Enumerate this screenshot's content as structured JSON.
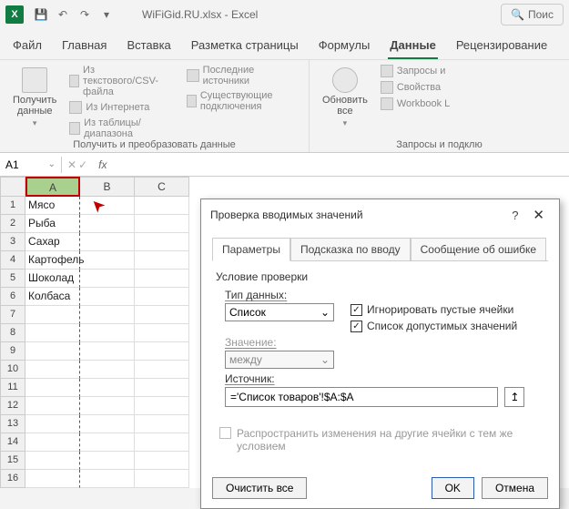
{
  "title": {
    "filename": "WiFiGid.RU.xlsx",
    "app": "Excel"
  },
  "search_label": "Поис",
  "tabs": [
    "Файл",
    "Главная",
    "Вставка",
    "Разметка страницы",
    "Формулы",
    "Данные",
    "Рецензирование"
  ],
  "active_tab": "Данные",
  "ribbon": {
    "get_data": "Получить данные",
    "from_csv": "Из текстового/CSV-файла",
    "from_web": "Из Интернета",
    "from_table": "Из таблицы/диапазона",
    "recent": "Последние источники",
    "existing": "Существующие подключения",
    "group1_label": "Получить и преобразовать данные",
    "refresh": "Обновить все",
    "queries": "Запросы и",
    "properties": "Свойства",
    "workbook": "Workbook L",
    "group2_label": "Запросы и подклю"
  },
  "namebox": "A1",
  "columns": [
    "A",
    "B",
    "C"
  ],
  "cells": {
    "a": [
      "Мясо",
      "Рыба",
      "Сахар",
      "Картофель",
      "Шоколад",
      "Колбаса",
      "",
      "",
      "",
      "",
      "",
      "",
      "",
      "",
      "",
      ""
    ]
  },
  "dialog": {
    "title": "Проверка вводимых значений",
    "tabs": [
      "Параметры",
      "Подсказка по вводу",
      "Сообщение об ошибке"
    ],
    "section": "Условие проверки",
    "type_label": "Тип данных:",
    "type_value": "Список",
    "value_label": "Значение:",
    "value_value": "между",
    "ignore_blank": "Игнорировать пустые ячейки",
    "in_cell_dropdown": "Список допустимых значений",
    "source_label": "Источник:",
    "source_value": "='Список товаров'!$A:$A",
    "propagate": "Распространить изменения на другие ячейки с тем же условием",
    "clear_all": "Очистить все",
    "ok": "OK",
    "cancel": "Отмена"
  }
}
